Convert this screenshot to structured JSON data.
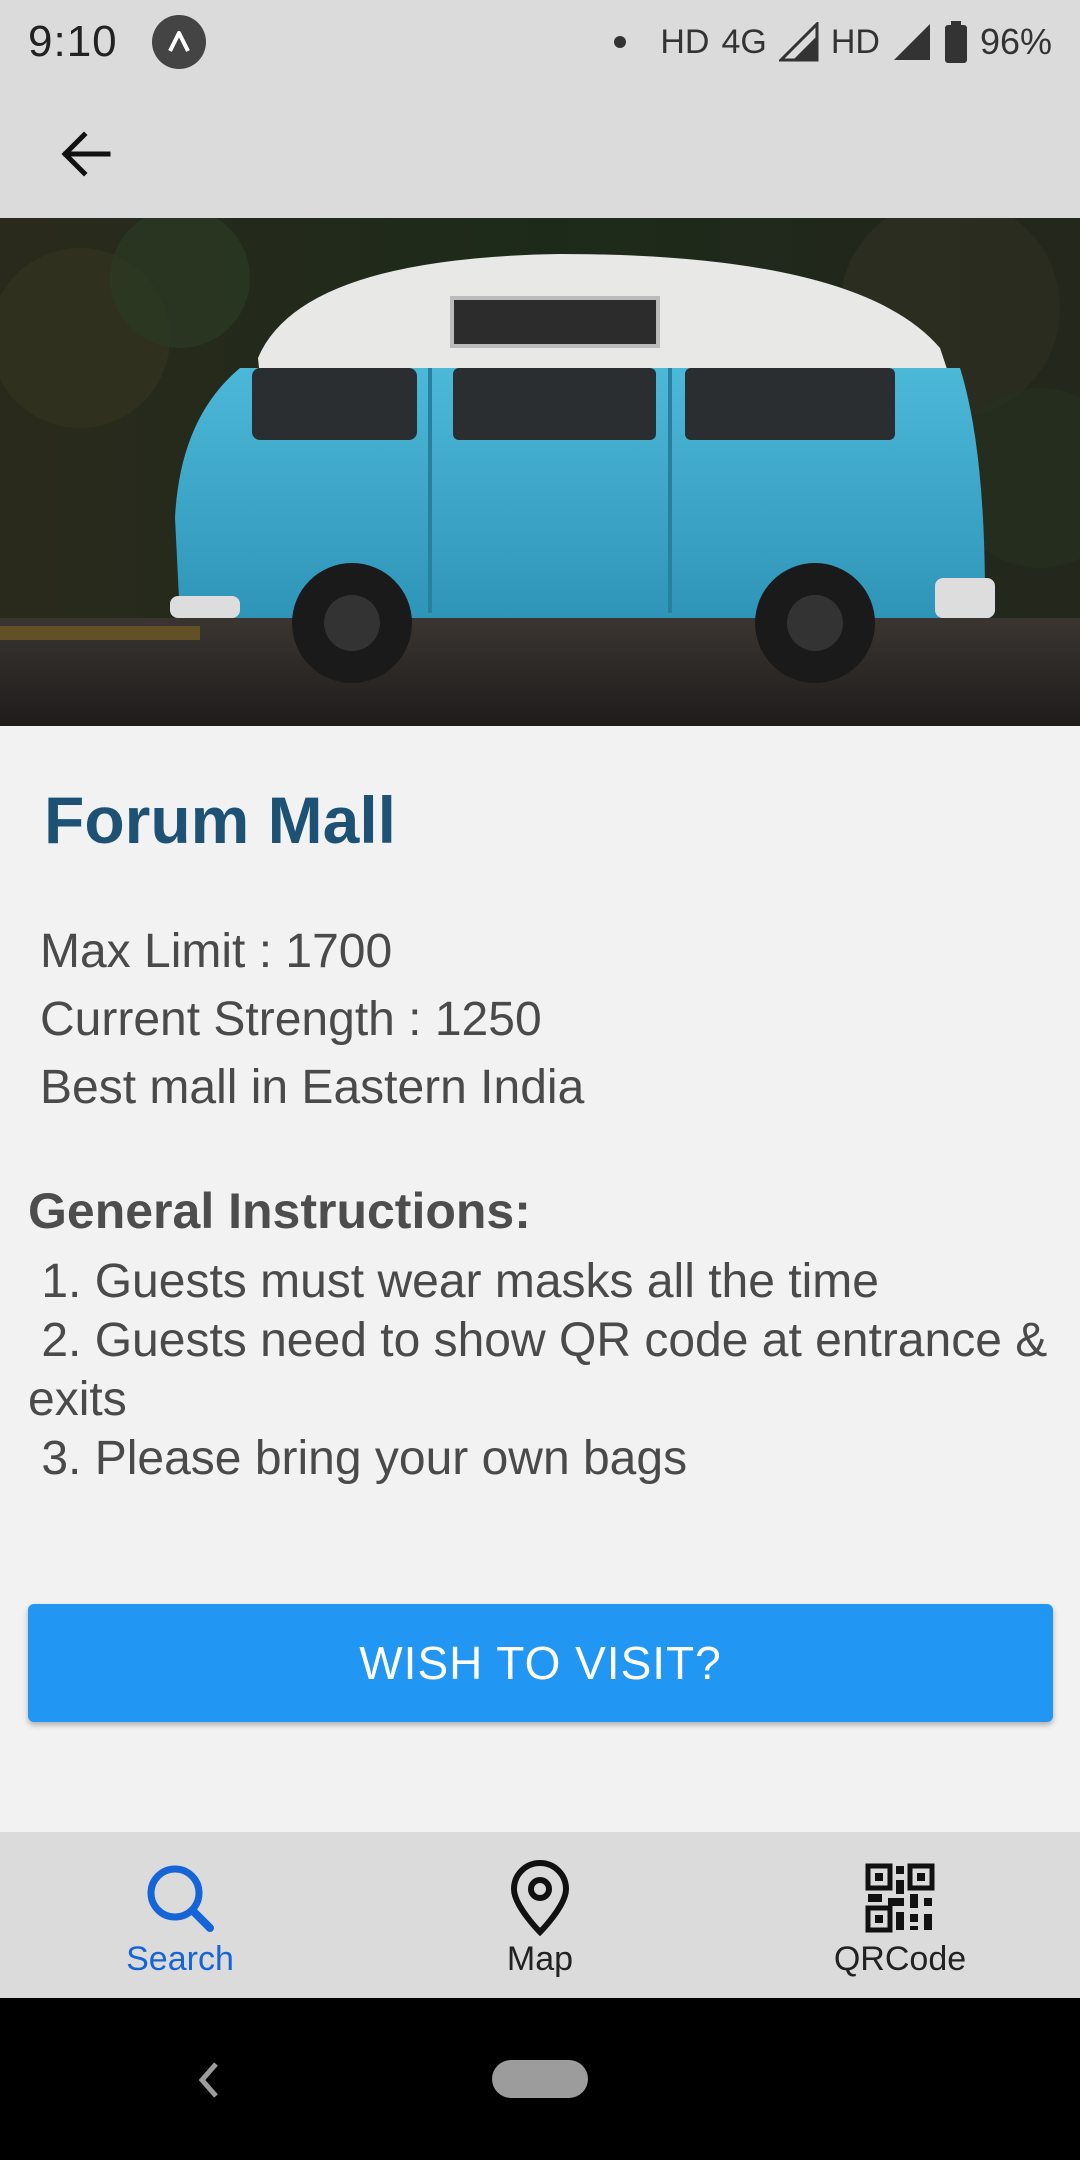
{
  "status_bar": {
    "time": "9:10",
    "hd1": "HD",
    "network": "4G",
    "hd2": "HD",
    "battery": "96%"
  },
  "place": {
    "title": "Forum Mall",
    "max_limit": "Max Limit : 1700",
    "current_strength": "Current Strength : 1250",
    "description": "Best mall in Eastern India"
  },
  "instructions": {
    "heading": "General Instructions:",
    "items": [
      " 1. Guests must wear masks all the time",
      " 2. Guests need to show QR code at entrance & exits",
      " 3. Please bring your own bags"
    ]
  },
  "visit_button": {
    "label": "WISH TO VISIT?"
  },
  "bottom_nav": {
    "items": [
      {
        "label": "Search",
        "icon": "search-icon"
      },
      {
        "label": "Map",
        "icon": "map-pin-icon"
      },
      {
        "label": "QRCode",
        "icon": "qr-code-icon"
      }
    ]
  },
  "colors": {
    "title": "#1d5274",
    "accent": "#2196f3",
    "nav_active": "#1565d8"
  }
}
